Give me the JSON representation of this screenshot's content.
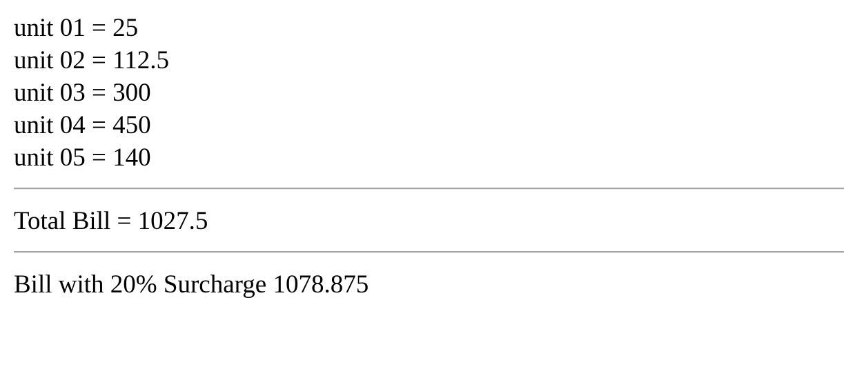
{
  "units": [
    {
      "label": "unit 01 = 25"
    },
    {
      "label": "unit 02 = 112.5"
    },
    {
      "label": "unit 03 = 300"
    },
    {
      "label": "unit 04 = 450"
    },
    {
      "label": "unit 05 = 140"
    }
  ],
  "total": {
    "text": "Total Bill = 1027.5"
  },
  "surcharge": {
    "text": "Bill with 20% Surcharge 1078.875"
  },
  "colors": {
    "text": "#000000",
    "rule": "#a6a6a6",
    "background": "#ffffff"
  }
}
